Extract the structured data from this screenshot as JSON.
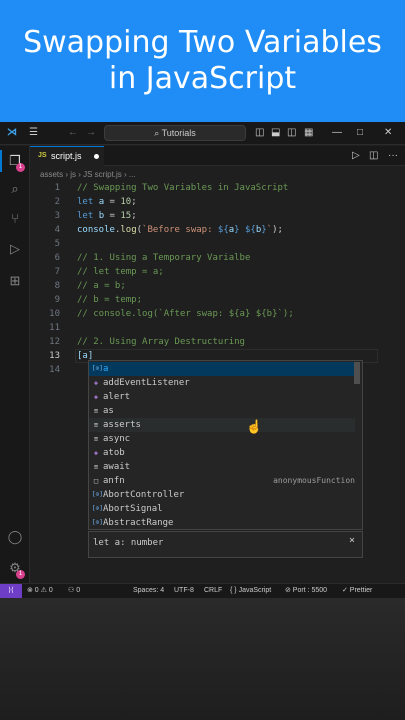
{
  "banner": {
    "line1": "Swapping Two Variables",
    "line2": "in JavaScript"
  },
  "titlebar": {
    "search": "⌕ Tutorials"
  },
  "tab": {
    "lang": "JS",
    "name": "script.js"
  },
  "breadcrumb": "assets  ›  js  ›  JS  script.js  ›  ...",
  "code_lines": [
    {
      "n": "1"
    },
    {
      "n": "2"
    },
    {
      "n": "3"
    },
    {
      "n": "4"
    },
    {
      "n": "5"
    },
    {
      "n": "6"
    },
    {
      "n": "7"
    },
    {
      "n": "8"
    },
    {
      "n": "9"
    },
    {
      "n": "10"
    },
    {
      "n": "11"
    },
    {
      "n": "12"
    },
    {
      "n": "13"
    },
    {
      "n": "14"
    }
  ],
  "code": {
    "l1": "// Swapping Two Variables in JavaScript",
    "l2_kw": "let",
    "l2_var": "a",
    "l2_op": " = ",
    "l2_num": "10",
    "l2_end": ";",
    "l3_kw": "let",
    "l3_var": "b",
    "l3_op": " = ",
    "l3_num": "15",
    "l3_end": ";",
    "l4_obj": "console",
    "l4_dot": ".",
    "l4_fn": "log",
    "l4_open": "(",
    "l4_str1": "`Before swap: ",
    "l4_t1": "${",
    "l4_v1": "a",
    "l4_t1e": "}",
    "l4_sp": " ",
    "l4_t2": "${",
    "l4_v2": "b",
    "l4_t2e": "}",
    "l4_str2": "`",
    "l4_close": ");",
    "l6": "// 1. Using a Temporary Varialbe",
    "l7": "// let temp = a;",
    "l8": "// a = b;",
    "l9": "// b = temp;",
    "l10": "// console.log(`After swap: ${a} ${b}`);",
    "l12": "// 2. Using Array Destructuring",
    "l13": "[a]"
  },
  "suggestions": [
    {
      "icon": "[⊙]",
      "label": "a",
      "detail": ""
    },
    {
      "icon": "◈",
      "label": "addEventListener",
      "detail": ""
    },
    {
      "icon": "◈",
      "label": "alert",
      "detail": ""
    },
    {
      "icon": "≡",
      "label": "as",
      "detail": ""
    },
    {
      "icon": "≡",
      "label": "asserts",
      "detail": ""
    },
    {
      "icon": "≡",
      "label": "async",
      "detail": ""
    },
    {
      "icon": "◈",
      "label": "atob",
      "detail": ""
    },
    {
      "icon": "≡",
      "label": "await",
      "detail": ""
    },
    {
      "icon": "□",
      "label": "anfn",
      "detail": "anonymousFunction"
    },
    {
      "icon": "[⊙]",
      "label": "AbortController",
      "detail": ""
    },
    {
      "icon": "[⊙]",
      "label": "AbortSignal",
      "detail": ""
    },
    {
      "icon": "[⊙]",
      "label": "AbstractRange",
      "detail": ""
    }
  ],
  "detail_panel": {
    "text": "let a: number",
    "close": "×"
  },
  "statusbar": {
    "remote": "⟩⟨",
    "problems": "⊗ 0 ⚠ 0",
    "ports_count": "⚇ 0",
    "spaces": "Spaces: 4",
    "encoding": "UTF-8",
    "eol": "CRLF",
    "language": "{ } JavaScript",
    "port": "⊘ Port : 5500",
    "prettier": "✓ Prettier"
  },
  "badges": {
    "explorer": "1",
    "settings": "1"
  },
  "colors": {
    "banner": "#1f8df5",
    "accent": "#0078d4",
    "selection": "#04395e"
  }
}
